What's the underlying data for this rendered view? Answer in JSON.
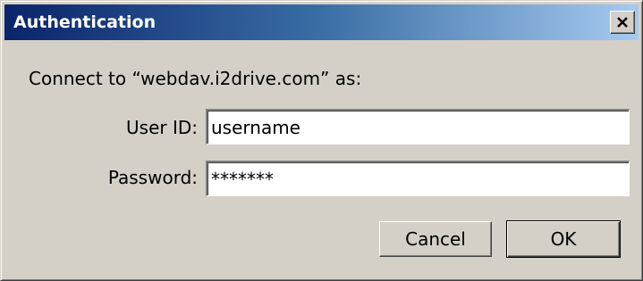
{
  "window": {
    "title": "Authentication",
    "close_icon": "close-icon"
  },
  "prompt": "Connect to “webdav.i2drive.com” as:",
  "form": {
    "user_label": "User ID:",
    "user_value": "username",
    "password_label": "Password:",
    "password_value": "*******"
  },
  "buttons": {
    "cancel": "Cancel",
    "ok": "OK"
  },
  "colors": {
    "titlebar_start": "#0a246a",
    "titlebar_end": "#a6caf0",
    "dialog_bg": "#d4d0c8"
  }
}
